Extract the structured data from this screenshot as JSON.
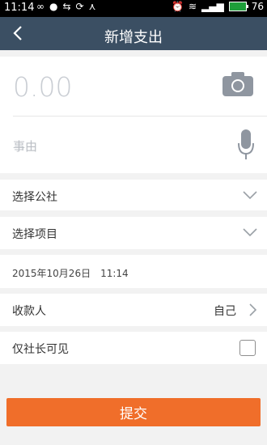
{
  "status_bar": {
    "time": "11:14",
    "battery": "76",
    "icons": [
      "infinity-icon",
      "chat-icon",
      "usb-icon",
      "sync-icon",
      "network-icon",
      "alarm-icon",
      "wifi-icon",
      "signal-icon",
      "battery-icon"
    ]
  },
  "header": {
    "title": "新增支出",
    "back_icon": "back-arrow-icon"
  },
  "form": {
    "amount": "0.00",
    "reason_placeholder": "事由",
    "commune_label": "选择公社",
    "project_label": "选择项目",
    "datetime": "2015年10月26日　11:14",
    "payee_label": "收款人",
    "payee_value": "自己",
    "visibility_label": "仅社长可见",
    "visibility_checked": false
  },
  "actions": {
    "submit_label": "提交"
  },
  "colors": {
    "header_bg": "#3b4f63",
    "submit_bg": "#f06e2a",
    "page_bg": "#f2f2f2"
  }
}
